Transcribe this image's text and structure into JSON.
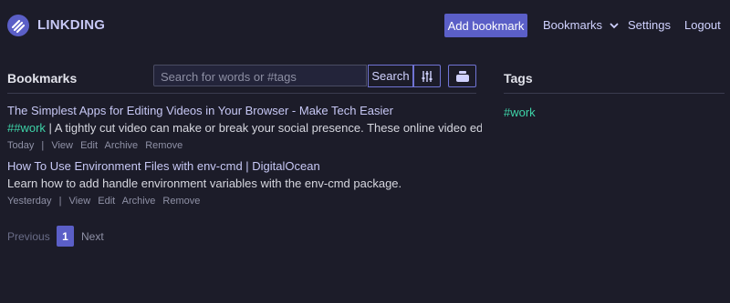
{
  "header": {
    "app_name": "LINKDING",
    "add_bookmark_label": "Add bookmark",
    "nav": {
      "bookmarks_label": "Bookmarks",
      "settings_label": "Settings",
      "logout_label": "Logout"
    }
  },
  "bookmarks_panel": {
    "title": "Bookmarks",
    "search": {
      "placeholder": "Search for words or #tags",
      "button_label": "Search"
    },
    "items": [
      {
        "title": "The Simplest Apps for Editing Videos in Your Browser - Make Tech Easier",
        "tag": "##work",
        "description": " | A tightly cut video can make or break your social presence. These online video editors...",
        "date": "Today",
        "actions": [
          "View",
          "Edit",
          "Archive",
          "Remove"
        ]
      },
      {
        "title": "How To Use Environment Files with env-cmd | DigitalOcean",
        "tag": "",
        "description": "Learn how to add handle environment variables with the env-cmd package.",
        "date": "Yesterday",
        "actions": [
          "View",
          "Edit",
          "Archive",
          "Remove"
        ]
      }
    ]
  },
  "tags_panel": {
    "title": "Tags",
    "tags": [
      "#work"
    ]
  },
  "pagination": {
    "previous_label": "Previous",
    "current_page": "1",
    "next_label": "Next"
  },
  "colors": {
    "background": "#1c1c29",
    "accent": "#5b5fc7",
    "tag": "#3ed3a8",
    "link": "#c7c8f5"
  }
}
